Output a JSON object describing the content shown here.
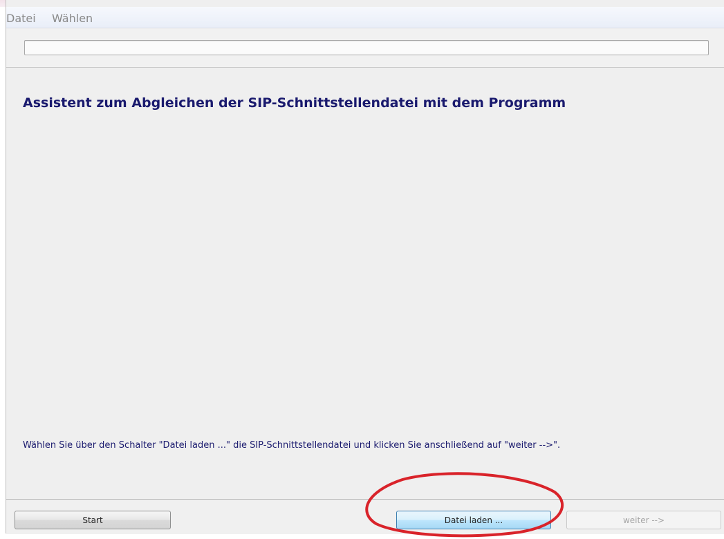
{
  "menu": {
    "items": [
      "Datei",
      "Wählen"
    ]
  },
  "main": {
    "heading": "Assistent zum Abgleichen der SIP-Schnittstellendatei mit dem Programm",
    "instruction": "Wählen Sie über den Schalter \"Datei laden ...\" die SIP-Schnittstellendatei und klicken Sie anschließend auf \"weiter -->\"."
  },
  "footer": {
    "start_label": "Start",
    "load_label": "Datei laden ...",
    "next_label": "weiter -->"
  },
  "colors": {
    "heading_text": "#1a1a6e",
    "annotation_ellipse": "#d9232a",
    "focused_button_border": "#3c7fb1"
  }
}
